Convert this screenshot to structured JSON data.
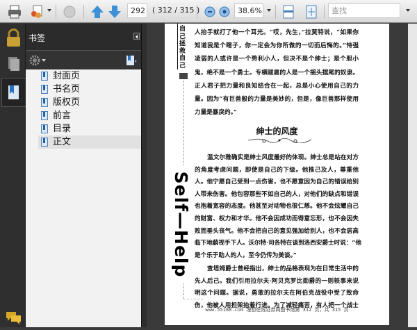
{
  "toolbar": {
    "page_number": "292",
    "page_count": "( 312 / 315 )",
    "zoom": "38.6%",
    "search_placeholder": "查找"
  },
  "bookmarks": {
    "title": "书签",
    "items": [
      {
        "label": "封面页"
      },
      {
        "label": "书名页"
      },
      {
        "label": "版权页"
      },
      {
        "label": "前言"
      },
      {
        "label": "目录"
      },
      {
        "label": "正文",
        "selected": true
      }
    ]
  },
  "document": {
    "side_title": "自己拯救自己",
    "side_english": "Self—Help",
    "para1": [
      "人抬手就打了他一个耳光。“哎，先生，”拉莫特说，“如果你",
      "知道我是个瞎子，你一定会为你所做的一切而后悔的。”恃强",
      "凌弱的人或许是一个势利小人，但决不是个绅士；是个胆小",
      "鬼，绝不是一个勇士。专横跋扈的人是一个摇头摆尾的奴隶。",
      "正人君子把力量和良知结合在一起，总是小心使用自己的力",
      "量。因为“有巨兽般的力量是美妙的，但是，像巨兽那样使用",
      "力量是暴戾的。”"
    ],
    "heading": "绅士的风度",
    "para2": [
      "温文尔雅确实是绅士风度最好的体现。绅士总是站在对方",
      "的角度考虑问题，即使是自己的下级。他推己及人，尊重他",
      "人。他宁愿自己受到一点伤害，也不愿意因为自己的错误给别",
      "人带来伤害。他包容那些不如自己的人，对他们的缺点和错误",
      "也抱着宽容的态度。他甚至对动物也很仁慈。他不会炫耀自己",
      "的财富、权力和才华。他不会因成功而得意忘形，也不会因失",
      "败而垂头丧气。他不会把自己的意见强加给别人，也不会居高",
      "临下地藐视手下人。沃尔特·司各特在谈到洛西安爵士时说：“他",
      "是个乐于助人的人，至今仍传为美谈。”"
    ],
    "para3": [
      "查塔姆爵士曾经指出，绅士的品格表现为在日常生活中的",
      "先人后己。我们引用拉尔夫·阿贝克罗比勋爵的一则轶事来说",
      "明这个问题。据说，勇敢的拉尔夫在阿伯克战役中受了致命",
      "伤，他被人用担架抬着行进。为了减轻痛苦，有人把一个战士"
    ],
    "footer": "www.55188.com 理想在线证券网图书馆第 312 页，共 315 页"
  }
}
